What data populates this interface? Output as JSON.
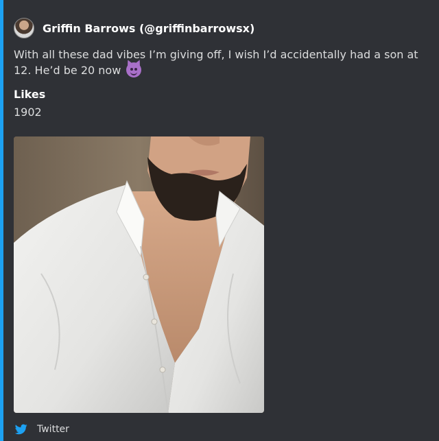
{
  "embed": {
    "accent_color": "#1da1f2",
    "author": {
      "name": "Griffin Barrows (@griffinbarrowsx)",
      "avatar": "profile-photo"
    },
    "description": "With all these dad vibes I’m giving off, I wish I’d accidentally had a son at 12. He’d be 20 now",
    "description_emoji": "smiling-devil-emoji",
    "fields": [
      {
        "name": "Likes",
        "value": "1902"
      }
    ],
    "image": "photo-man-white-shirt",
    "footer": {
      "text": "Twitter",
      "icon": "twitter-bird-icon"
    }
  }
}
